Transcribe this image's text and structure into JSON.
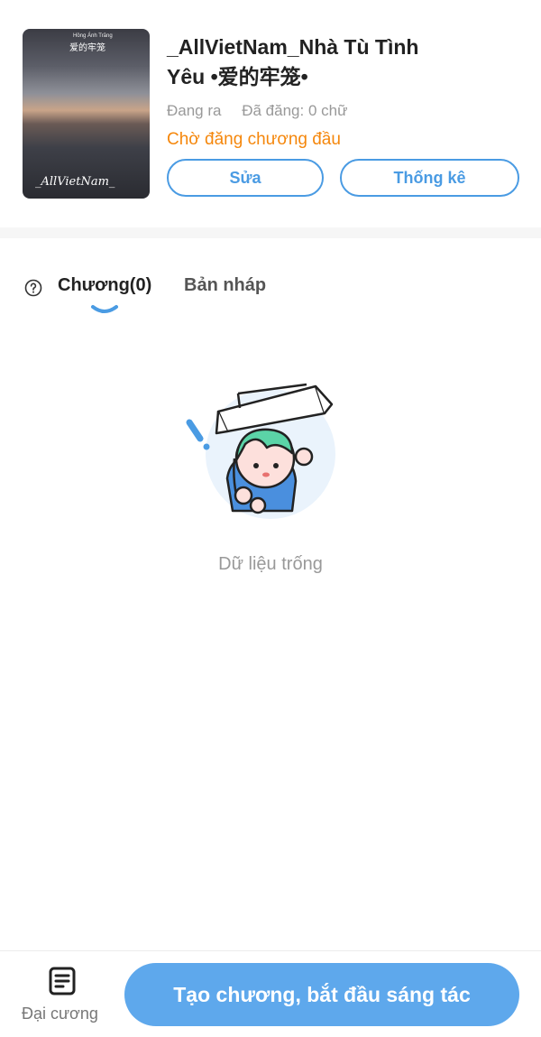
{
  "book": {
    "title_line1": "_AllVietNam_Nhà Tù Tình",
    "title_line2": "Yêu •爱的牢笼•",
    "status": "Đang ra",
    "word_count": "Đã đăng: 0 chữ",
    "pending_notice": "Chờ đăng chương đầu",
    "cover": {
      "line1": "Hồng Ánh Trăng",
      "line2": "爱的牢笼",
      "signature": "_AllVietNam_"
    }
  },
  "actions": {
    "edit_label": "Sửa",
    "stats_label": "Thống kê"
  },
  "tabs": [
    {
      "label": "Chương(0)",
      "active": true
    },
    {
      "label": "Bản nháp",
      "active": false
    }
  ],
  "empty_state": {
    "text": "Dữ liệu trống"
  },
  "bottom_bar": {
    "outline_label": "Đại cương",
    "create_label": "Tạo chương, bắt đầu sáng tác"
  },
  "colors": {
    "accent": "#4a9be3",
    "pending": "#f5870c",
    "create_button": "#5ea8ec"
  },
  "icons": {
    "help": "question-circle-icon",
    "outline": "document-list-icon"
  }
}
